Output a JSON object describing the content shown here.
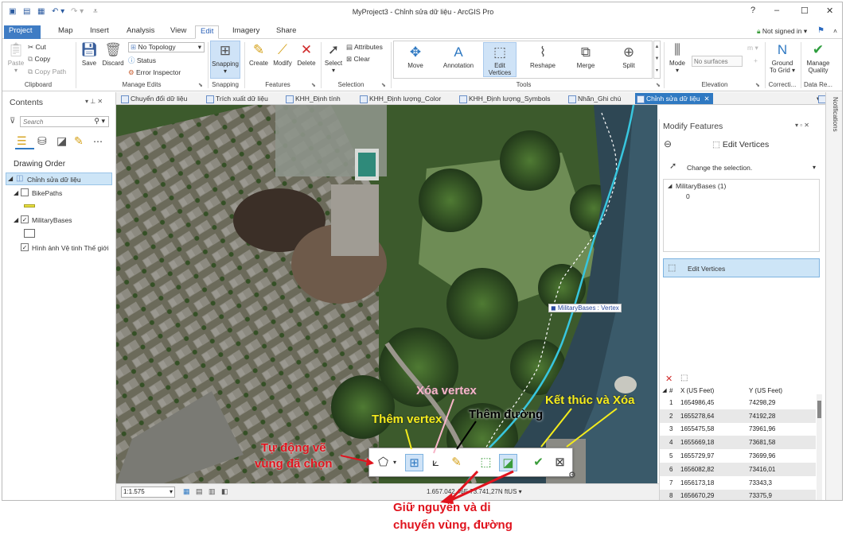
{
  "app": {
    "title": "MyProject3 - Chỉnh sửa dữ liệu - ArcGIS Pro",
    "help": "?",
    "minimize": "–",
    "maximize": "☐",
    "close": "✕"
  },
  "ribbon_tabs": [
    "Project",
    "Map",
    "Insert",
    "Analysis",
    "View",
    "Edit",
    "Imagery",
    "Share"
  ],
  "account": {
    "label": "Not signed in ▾"
  },
  "clipboard": {
    "paste": "Paste",
    "cut": "Cut",
    "copy": "Copy",
    "copy_path": "Copy Path",
    "label": "Clipboard"
  },
  "manage_edits": {
    "save": "Save",
    "discard": "Discard",
    "topology": "No Topology",
    "status": "Status",
    "error_inspector": "Error Inspector",
    "label": "Manage Edits"
  },
  "snapping": {
    "button": "Snapping",
    "label": "Snapping"
  },
  "features": {
    "create": "Create",
    "modify": "Modify",
    "delete": "Delete",
    "label": "Features"
  },
  "selection": {
    "select": "Select",
    "attributes": "Attributes",
    "clear": "Clear",
    "label": "Selection"
  },
  "tools": {
    "move": "Move",
    "annotation": "Annotation",
    "edit_vertices": "Edit Vertices",
    "reshape": "Reshape",
    "merge": "Merge",
    "split": "Split",
    "label": "Tools"
  },
  "elevation": {
    "mode": "Mode",
    "surface_placeholder": "No surfaces",
    "label": "Elevation"
  },
  "corrections": {
    "ground_to_grid": "Ground To Grid ▾",
    "label": "Correcti..."
  },
  "data_reviewer": {
    "manage_quality": "Manage Quality",
    "label": "Data Re..."
  },
  "contents": {
    "title": "Contents",
    "search_placeholder": "Search",
    "drawing_order": "Drawing Order",
    "map_name": "Chỉnh sửa dữ liệu",
    "layers": [
      "BikePaths",
      "MilitaryBases",
      "Hình ảnh Vệ tinh Thế giới"
    ]
  },
  "doc_tabs": [
    "Chuyển đổi dữ liệu",
    "Trích xuất dữ liệu",
    "KHH_Định tính",
    "KHH_Định lượng_Color",
    "KHH_Định lượng_Symbols",
    "Nhãn_Ghi chú",
    "Chỉnh sửa dữ liệu"
  ],
  "map": {
    "vertex_label": "MilitaryBases : Vertex",
    "scale": "1:1.575",
    "coords": "1.657.042,46E 73.741,27N ftUS ▾"
  },
  "modify": {
    "title": "Modify Features",
    "tool_title": "Edit Vertices",
    "change_selection": "Change the selection.",
    "layer_item": "MilitaryBases (1)",
    "feature_id": "0",
    "tool_row": "Edit Vertices"
  },
  "vertex_table": {
    "columns": [
      "#",
      "X (US Feet)",
      "Y (US Feet)"
    ],
    "rows": [
      [
        "1",
        "1654986,45",
        "74298,29"
      ],
      [
        "2",
        "1655278,64",
        "74192,28"
      ],
      [
        "3",
        "1655475,58",
        "73961,96"
      ],
      [
        "4",
        "1655669,18",
        "73681,58"
      ],
      [
        "5",
        "1655729,97",
        "73699,96"
      ],
      [
        "6",
        "1656082,82",
        "73416,01"
      ],
      [
        "7",
        "1656173,18",
        "73343,3"
      ],
      [
        "8",
        "1656670,29",
        "73375,9"
      ]
    ]
  },
  "notifications": "Notifications",
  "annotations": {
    "auto": "Tự động vẽ\nvùng đã chọn",
    "add_vertex": "Thêm vertex",
    "delete_vertex": "Xóa vertex",
    "add_line": "Thêm đường",
    "finish": "Kết thúc và Xóa",
    "keep": "Giữ nguyên và di\nchuyển vùng, đường"
  },
  "colors": {
    "accent": "#2f79c2",
    "ann_red": "#e0141e",
    "ann_yellow": "#f4ec1c",
    "ann_pink": "#f7b5c8",
    "ann_black": "#000000",
    "polygon": "#38c6de"
  }
}
